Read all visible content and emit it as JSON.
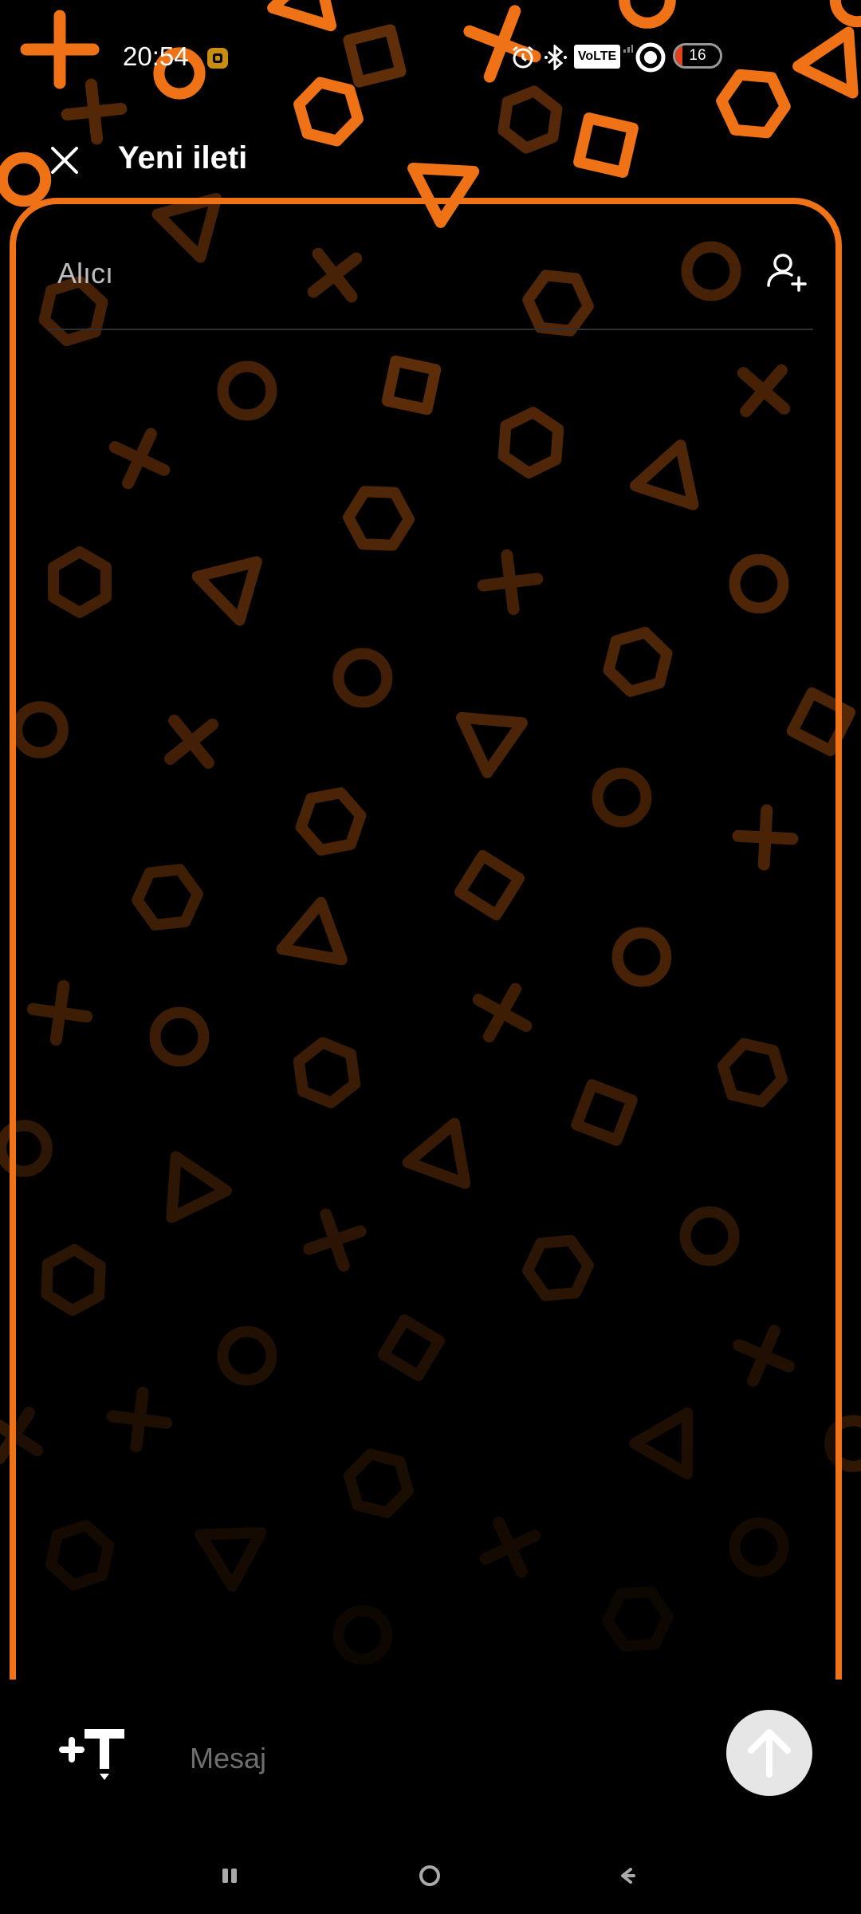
{
  "status_bar": {
    "time": "20:54",
    "volte_label": "VoLTE",
    "battery_level": "16",
    "icons": [
      "notification-app-icon",
      "alarm-icon",
      "bluetooth-icon",
      "volte-icon",
      "signal-icon",
      "data-saver-icon",
      "battery-icon"
    ]
  },
  "toolbar": {
    "title": "Yeni ileti",
    "close_icon": "close-icon"
  },
  "recipient": {
    "placeholder": "Alıcı",
    "value": "",
    "add_contact_icon": "add-contact-icon"
  },
  "composer": {
    "text_tool_icon": "text-format-icon",
    "message_placeholder": "Mesaj",
    "message_value": "",
    "send_icon": "arrow-up-icon"
  },
  "nav_bar": {
    "icons": [
      "recents-icon",
      "home-icon",
      "back-icon"
    ]
  },
  "theme": {
    "accent": "#f07216",
    "background": "#000000",
    "send_button": "#e6e6e6"
  }
}
